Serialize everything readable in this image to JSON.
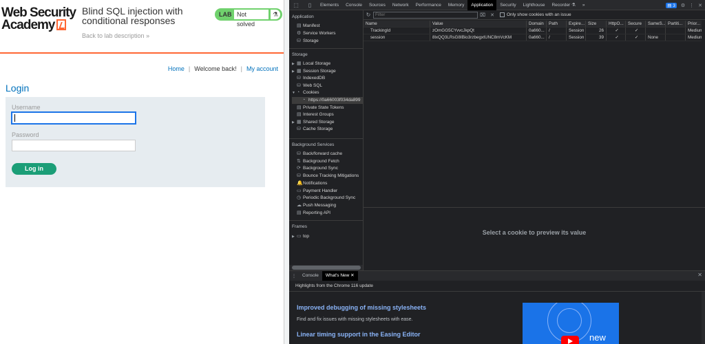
{
  "page": {
    "logo_line1": "Web Security",
    "logo_line2": "Academy",
    "lab_title": "Blind SQL injection with conditional responses",
    "back_link": "Back to lab description",
    "back_chevron": "»",
    "lab_badge": "LAB",
    "lab_status": "Not solved",
    "flask_icon": "flask-icon",
    "nav": {
      "home": "Home",
      "sep1": "|",
      "welcome": "Welcome back!",
      "sep2": "|",
      "account": "My account"
    },
    "login_heading": "Login",
    "username_label": "Username",
    "password_label": "Password",
    "login_button": "Log in",
    "colors": {
      "accent": "#ff6633",
      "link": "#0071bc",
      "lab_green": "#70d16d",
      "button": "#1b9e77"
    }
  },
  "devtools": {
    "tabs": [
      "Elements",
      "Console",
      "Sources",
      "Network",
      "Performance",
      "Memory",
      "Application",
      "Security",
      "Lighthouse",
      "Recorder ⚗",
      "»"
    ],
    "active_tab": "Application",
    "issue_count": "3",
    "sidebar": {
      "application_label": "Application",
      "application_items": [
        "Manifest",
        "Service Workers",
        "Storage"
      ],
      "storage_label": "Storage",
      "storage_items": [
        "Local Storage",
        "Session Storage",
        "IndexedDB",
        "Web SQL",
        "Cookies",
        "https://0a66003f034da899",
        "Private State Tokens",
        "Interest Groups",
        "Shared Storage",
        "Cache Storage"
      ],
      "background_label": "Background Services",
      "background_items": [
        "Back/forward cache",
        "Background Fetch",
        "Background Sync",
        "Bounce Tracking Mitigations",
        "Notifications",
        "Payment Handler",
        "Periodic Background Sync",
        "Push Messaging",
        "Reporting API"
      ],
      "frames_label": "Frames",
      "frames_items": [
        "top"
      ]
    },
    "toolbar": {
      "filter_placeholder": "Filter",
      "only_issues_label": "Only show cookies with an issue"
    },
    "table": {
      "headers": [
        "Name",
        "Value",
        "Domain",
        "Path",
        "Expire...",
        "Size",
        "HttpO...",
        "Secure",
        "SameS...",
        "Partiti...",
        "Prior..."
      ],
      "rows": [
        [
          "TrackingId",
          "zOmGG5CYvvcJkpQt",
          "0a660...",
          "/",
          "Session",
          "26",
          "✓",
          "✓",
          "",
          "",
          "Medium"
        ],
        [
          "session",
          "8lxQQ3LRsG8IBio3rzbegxtUNC8mVcKM",
          "0a660...",
          "/",
          "Session",
          "39",
          "✓",
          "✓",
          "None",
          "",
          "Medium"
        ]
      ]
    },
    "preview_message": "Select a cookie to preview its value",
    "drawer": {
      "tabs": [
        "Console",
        "What's New"
      ],
      "active_tab": "What's New",
      "heading": "Highlights from the Chrome 116 update",
      "feature1_title": "Improved debugging of missing stylesheets",
      "feature1_desc": "Find and fix issues with missing stylesheets with ease.",
      "feature2_title": "Linear timing support in the Easing Editor",
      "promo_text": "new"
    }
  }
}
